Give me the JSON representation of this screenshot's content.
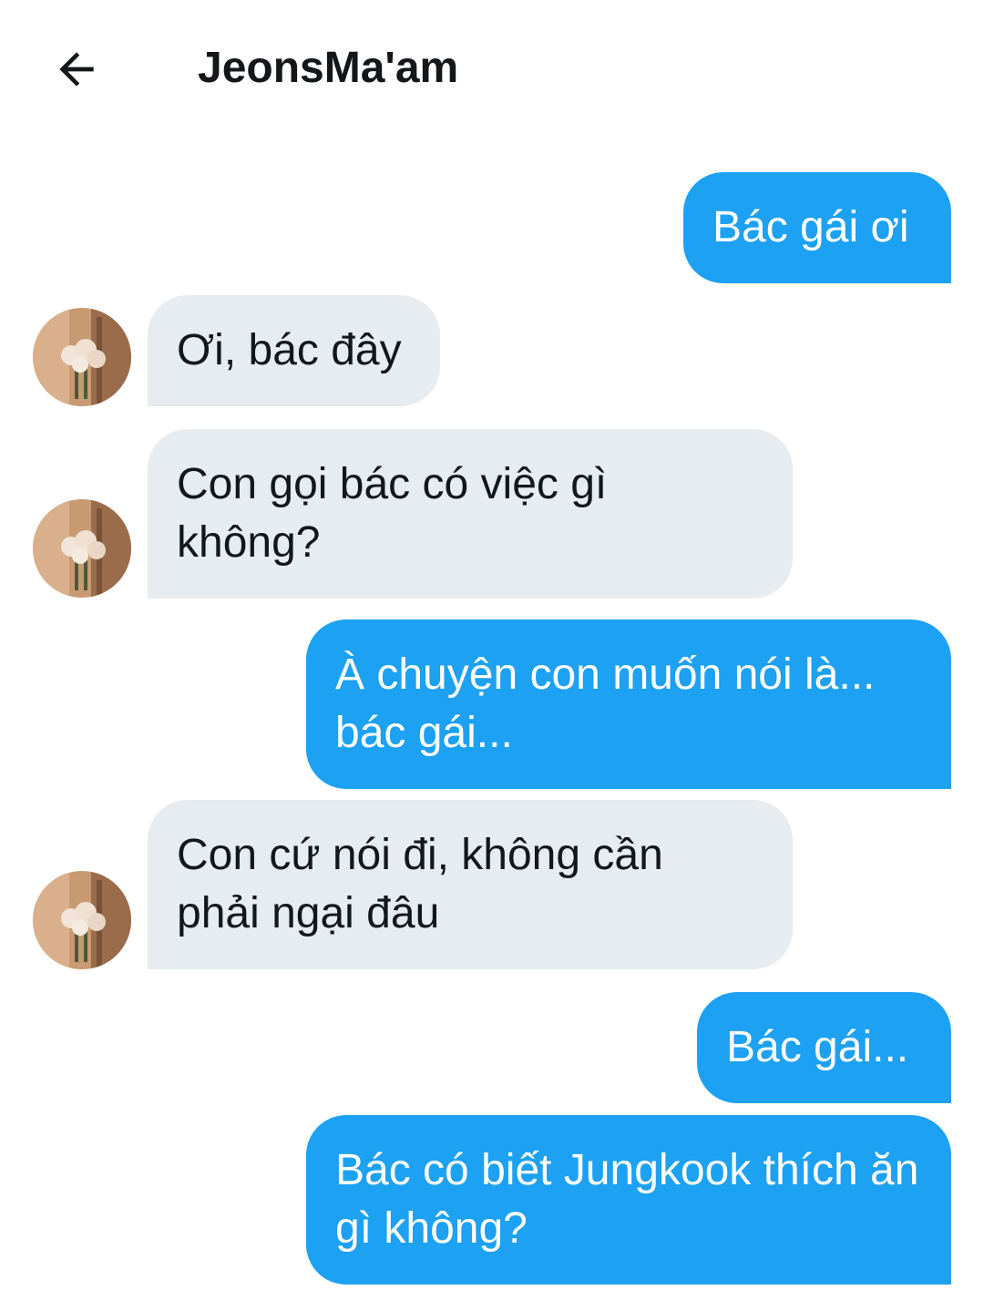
{
  "header": {
    "title": "JeonsMa'am",
    "back_icon": "arrow-left-icon"
  },
  "colors": {
    "outgoing_bubble": "#1da1f2",
    "incoming_bubble": "#e6ecf0",
    "text_dark": "#14171a"
  },
  "messages": [
    {
      "direction": "outgoing",
      "text": "Bác gái ơi"
    },
    {
      "direction": "incoming",
      "text": "Ơi, bác đây"
    },
    {
      "direction": "incoming",
      "text": "Con gọi bác có việc gì không?"
    },
    {
      "direction": "outgoing",
      "text": "À chuyện con muốn nói là... bác gái..."
    },
    {
      "direction": "incoming",
      "text": "Con cứ nói đi, không cần phải ngại đâu"
    },
    {
      "direction": "outgoing",
      "text": "Bác gái..."
    },
    {
      "direction": "outgoing",
      "text": "Bác có biết Jungkook thích ăn gì không?"
    }
  ],
  "avatar": {
    "icon": "flower-bouquet-avatar"
  }
}
